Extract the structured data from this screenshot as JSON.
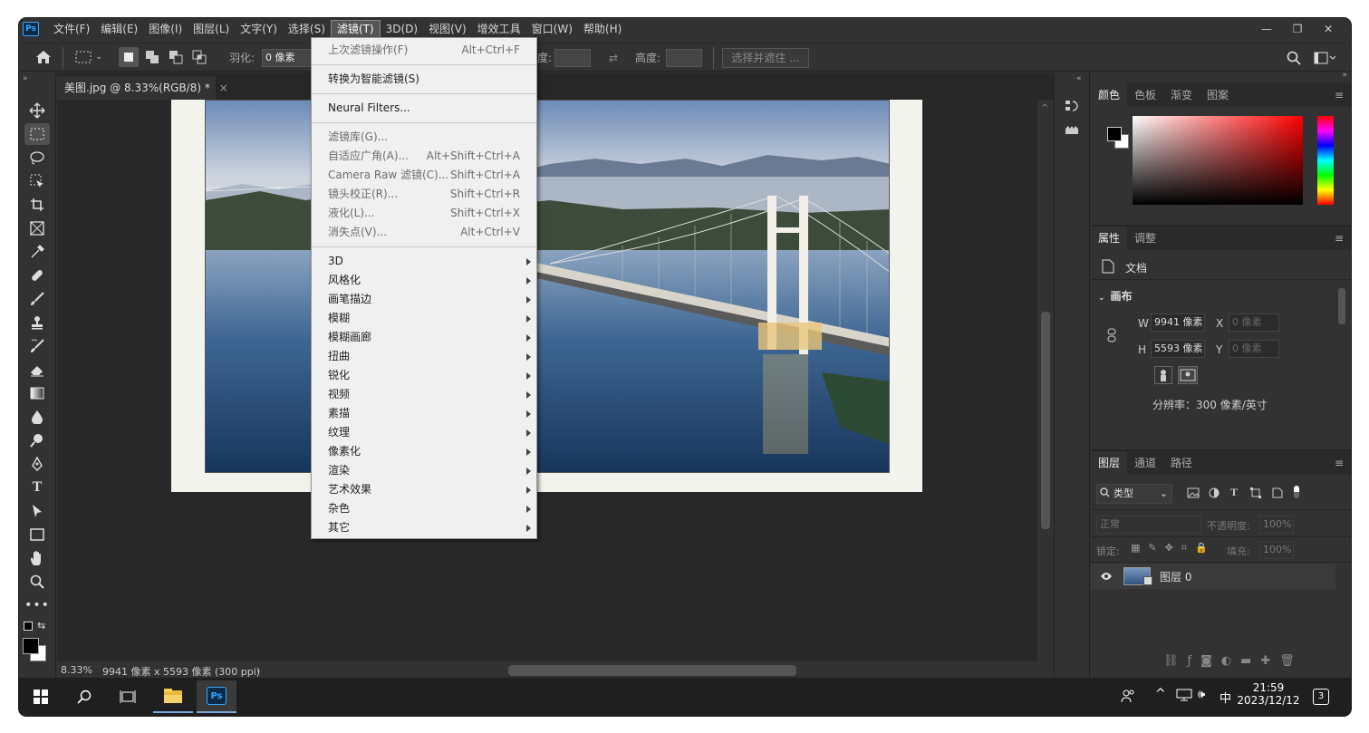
{
  "menubar": {
    "items": [
      "文件(F)",
      "编辑(E)",
      "图像(I)",
      "图层(L)",
      "文字(Y)",
      "选择(S)",
      "滤镜(T)",
      "3D(D)",
      "视图(V)",
      "增效工具",
      "窗口(W)",
      "帮助(H)"
    ],
    "active": "滤镜(T)",
    "logo": "Ps"
  },
  "options": {
    "feather_label": "羽化:",
    "feather_value": "0 像素",
    "width_label": "度:",
    "height_label": "高度:",
    "select_mask": "选择并遮住 ..."
  },
  "document": {
    "tab_title": "美图.jpg @ 8.33%(RGB/8) *",
    "close": "×"
  },
  "status": {
    "zoom": "8.33%",
    "info": "9941 像素 x 5593 像素 (300 ppi)",
    "arrow": "›"
  },
  "filter_menu": {
    "groups": [
      [
        {
          "label": "上次滤镜操作(F)",
          "shortcut": "Alt+Ctrl+F"
        }
      ],
      [
        {
          "label": "转换为智能滤镜(S)",
          "shortcut": ""
        }
      ],
      [
        {
          "label": "Neural Filters...",
          "shortcut": ""
        }
      ],
      [
        {
          "label": "滤镜库(G)...",
          "shortcut": ""
        },
        {
          "label": "自适应广角(A)...",
          "shortcut": "Alt+Shift+Ctrl+A"
        },
        {
          "label": "Camera Raw 滤镜(C)...",
          "shortcut": "Shift+Ctrl+A"
        },
        {
          "label": "镜头校正(R)...",
          "shortcut": "Shift+Ctrl+R"
        },
        {
          "label": "液化(L)...",
          "shortcut": "Shift+Ctrl+X"
        },
        {
          "label": "消失点(V)...",
          "shortcut": "Alt+Ctrl+V"
        }
      ]
    ],
    "submenus": [
      "3D",
      "风格化",
      "画笔描边",
      "模糊",
      "模糊画廊",
      "扭曲",
      "锐化",
      "视频",
      "素描",
      "纹理",
      "像素化",
      "渲染",
      "艺术效果",
      "杂色",
      "其它"
    ]
  },
  "color_panel": {
    "tabs": [
      "颜色",
      "色板",
      "渐变",
      "图案"
    ],
    "base_hue": "#ff0000"
  },
  "properties_panel": {
    "tabs": [
      "属性",
      "调整"
    ],
    "doc_label": "文档",
    "section": "画布",
    "w_label": "W",
    "w_value": "9941 像素",
    "h_label": "H",
    "h_value": "5593 像素",
    "x_label": "X",
    "x_value": "0 像素",
    "y_label": "Y",
    "y_value": "0 像素",
    "resolution": "分辨率：300 像素/英寸"
  },
  "layers_panel": {
    "tabs": [
      "图层",
      "通道",
      "路径"
    ],
    "filter_kind": "类型",
    "blend_mode": "正常",
    "opacity_label": "不透明度:",
    "opacity_value": "100%",
    "lock_label": "锁定:",
    "fill_label": "填充:",
    "fill_value": "100%",
    "layers": [
      {
        "name": "图层 0",
        "visible": true
      }
    ]
  },
  "taskbar": {
    "time": "21:59",
    "date": "2023/12/12",
    "ime": "中",
    "notifications": "3"
  }
}
